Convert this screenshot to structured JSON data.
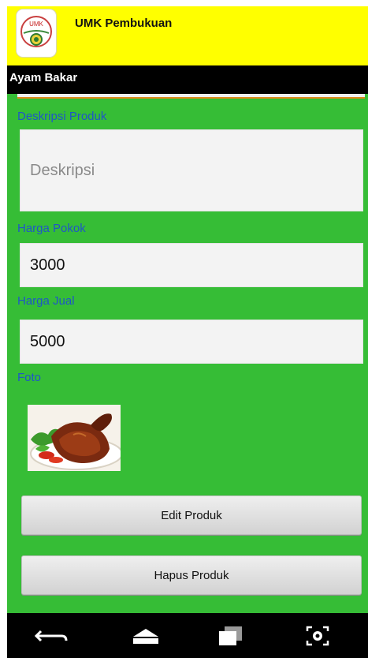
{
  "app": {
    "title": "UMK Pembukuan",
    "logo_text": "UMK"
  },
  "subbar": {
    "title": "Ayam Bakar"
  },
  "form": {
    "description": {
      "label": "Deskripsi Produk",
      "placeholder": "Deskripsi",
      "value": ""
    },
    "cost_price": {
      "label": "Harga Pokok",
      "value": "3000"
    },
    "sell_price": {
      "label": "Harga Jual",
      "value": "5000"
    },
    "photo": {
      "label": "Foto"
    }
  },
  "buttons": {
    "edit": "Edit Produk",
    "delete": "Hapus Produk"
  },
  "navbar": {
    "icons": [
      "back-icon",
      "home-icon",
      "recent-apps-icon",
      "screenshot-icon"
    ]
  },
  "colors": {
    "header": "#ffff00",
    "background": "#36bd36",
    "label": "#1f56c8",
    "bar": "#000000"
  }
}
